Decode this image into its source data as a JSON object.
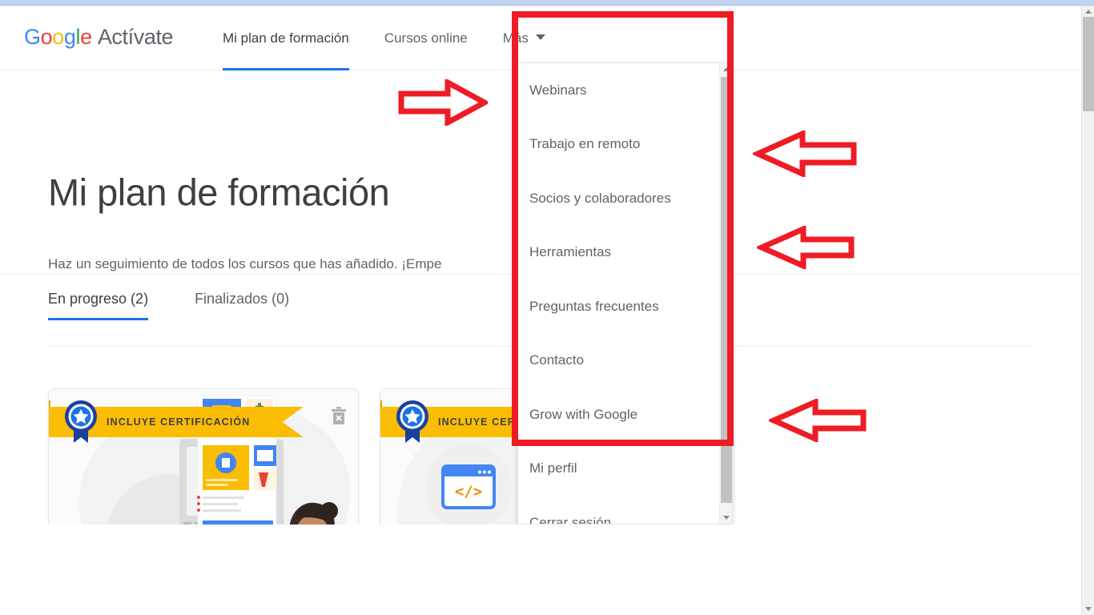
{
  "header": {
    "brand": {
      "google": [
        "G",
        "o",
        "o",
        "g",
        "l",
        "e"
      ],
      "product": "Actívate"
    },
    "nav": [
      {
        "label": "Mi plan de formación",
        "active": true,
        "has_caret": false
      },
      {
        "label": "Cursos online",
        "active": false,
        "has_caret": false
      },
      {
        "label": "Más",
        "active": false,
        "has_caret": true
      }
    ]
  },
  "dropdown": {
    "open": true,
    "items": [
      {
        "label": "Webinars"
      },
      {
        "label": "Trabajo en remoto"
      },
      {
        "label": "Socios y colaboradores"
      },
      {
        "label": "Herramientas"
      },
      {
        "label": "Preguntas frecuentes"
      },
      {
        "label": "Contacto"
      },
      {
        "label": "Grow with Google"
      },
      {
        "label": "Mi perfil"
      },
      {
        "label": "Cerrar sesión"
      }
    ]
  },
  "hero": {
    "title": "Mi plan de formación",
    "subtitle": "Haz un seguimiento de todos los cursos que has añadido. ¡Empe"
  },
  "tabs": [
    {
      "label": "En progreso (2)",
      "active": true
    },
    {
      "label": "Finalizados (0)",
      "active": false
    }
  ],
  "cards": [
    {
      "ribbon_label": "INCLUYE CERTIFICACIÓN",
      "badge_icon": "star-badge-icon",
      "delete_icon": "trash-icon",
      "art": "ecommerce-illustration"
    },
    {
      "ribbon_label": "INCLUYE CERTIFICACIÓN",
      "badge_icon": "star-badge-icon",
      "delete_icon": "trash-icon",
      "art": "code-illustration"
    }
  ],
  "annotations": {
    "color": "#ee1c25",
    "box": {
      "label": "highlight-rectangle"
    },
    "arrows": [
      {
        "direction": "right",
        "label": "arrow-right-mas-menu"
      },
      {
        "direction": "left",
        "label": "arrow-left-trabajo-en-remoto"
      },
      {
        "direction": "left",
        "label": "arrow-left-herramientas"
      },
      {
        "direction": "left",
        "label": "arrow-left-grow-with-google"
      }
    ]
  },
  "colors": {
    "google_blue": "#4285F4",
    "google_red": "#EA4335",
    "google_yellow": "#FBBC05",
    "google_green": "#34A853",
    "accent_blue": "#1a73e8",
    "ribbon_yellow": "#fbbc04",
    "annotation_red": "#ee1c25",
    "text_primary": "#3c4043",
    "text_secondary": "#5f6368"
  },
  "scrollbars": {
    "browser": {
      "label": "browser-vertical-scrollbar"
    },
    "dropdown": {
      "label": "dropdown-vertical-scrollbar"
    }
  }
}
